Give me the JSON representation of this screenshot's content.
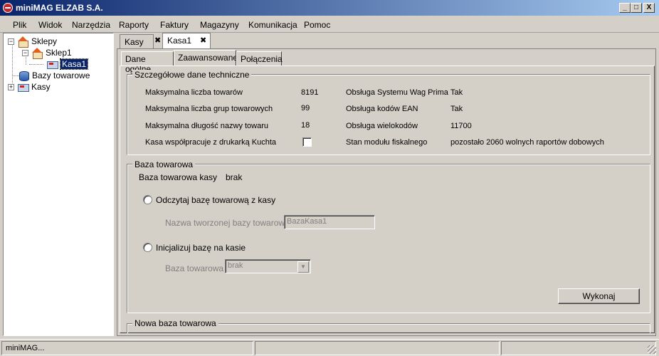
{
  "window": {
    "title": "miniMAG ELZAB S.A.",
    "minimize": "_",
    "maximize": "□",
    "close": "X"
  },
  "menu": [
    "Plik",
    "Widok",
    "Narzędzia",
    "Raporty",
    "Faktury",
    "Magazyny",
    "Komunikacja",
    "Pomoc"
  ],
  "tree": {
    "root": "Sklepy",
    "shop": "Sklep1",
    "register": "Kasa1",
    "databases": "Bazy towarowe",
    "registers": "Kasy"
  },
  "outer_tabs": [
    "Kasy",
    "Kasa1"
  ],
  "inner_tabs": [
    "Dane ogólne",
    "Zaawansowane",
    "Połączenia"
  ],
  "tech": {
    "legend": "Szczegółowe dane techniczne",
    "left": [
      {
        "label": "Maksymalna liczba towarów",
        "value": "8191"
      },
      {
        "label": "Maksymalna liczba grup towarowych",
        "value": "99"
      },
      {
        "label": "Maksymalna długość nazwy towaru",
        "value": "18"
      },
      {
        "label": "Kasa współpracuje z drukarką Kuchta",
        "value": ""
      }
    ],
    "right": [
      {
        "label": "Obsługa Systemu Wag Prima",
        "value": "Tak"
      },
      {
        "label": "Obsługa kodów EAN",
        "value": "Tak"
      },
      {
        "label": "Obsługa wielokodów",
        "value": "11700"
      },
      {
        "label": "Stan modułu fiskalnego",
        "value": "pozostało 2060 wolnych raportów dobowych"
      }
    ]
  },
  "base": {
    "legend": "Baza towarowa",
    "label": "Baza towarowa kasy",
    "value": "brak",
    "read_option": "Odczytaj bazę towarową z kasy",
    "name_label": "Nazwa tworzonej bazy towarowej",
    "name_value": "BazaKasa1",
    "init_option": "Inicjalizuj bazę na kasie",
    "combo_label": "Baza towarowa",
    "combo_value": "brak",
    "execute": "Wykonaj"
  },
  "new_base": {
    "legend": "Nowa baza towarowa"
  },
  "status": {
    "text": "miniMAG..."
  }
}
